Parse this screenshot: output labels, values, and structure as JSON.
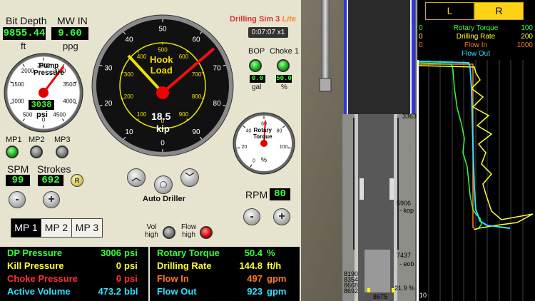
{
  "bit_depth": {
    "label": "Bit Depth",
    "value": "9855.44",
    "unit": "ft"
  },
  "mw_in": {
    "label": "MW IN",
    "value": "9.60",
    "unit": "ppg"
  },
  "pump_gauge": {
    "title1": "Pump",
    "title2": "Pressure",
    "value": "3038",
    "unit": "psi",
    "ticks": [
      "0",
      "500",
      "1000",
      "1500",
      "2000",
      "2500",
      "3000",
      "3500",
      "4000",
      "4500"
    ]
  },
  "hook_gauge": {
    "title1": "Hook",
    "title2": "Load",
    "value": "18.5",
    "unit": "kip",
    "outer_ticks": [
      "0",
      "10",
      "20",
      "30",
      "40",
      "50",
      "60",
      "70",
      "80",
      "90"
    ],
    "inner_ticks": [
      "0",
      "100",
      "200",
      "300",
      "400",
      "500",
      "600",
      "700",
      "800",
      "900"
    ]
  },
  "torque_gauge": {
    "title1": "Rotary",
    "title2": "Torque",
    "unit": "%",
    "ticks": [
      "0",
      "20",
      "40",
      "60",
      "80",
      "100"
    ]
  },
  "app_title": {
    "name": "Drilling Sim 3",
    "edition": "Lite"
  },
  "timer": "0:07:07 x1",
  "bop": {
    "label": "BOP",
    "value": "0.0",
    "unit": "gal"
  },
  "choke": {
    "label": "Choke 1",
    "value": "50.0",
    "unit": "%"
  },
  "pumps": {
    "mp1": "MP1",
    "mp2": "MP2",
    "mp3": "MP3"
  },
  "spm": {
    "label": "SPM",
    "value": "99"
  },
  "strokes": {
    "label": "Strokes",
    "value": "692",
    "reset": "R"
  },
  "buttons": {
    "minus": "-",
    "plus": "+",
    "auto_driller": "Auto Driller"
  },
  "rpm": {
    "label": "RPM",
    "value": "80"
  },
  "mp_tabs": [
    "MP 1",
    "MP 2",
    "MP 3"
  ],
  "alarms": {
    "vol_l1": "Vol",
    "vol_l2": "high",
    "flow_l1": "Flow",
    "flow_l2": "high"
  },
  "readouts_left": [
    {
      "label": "DP Pressure",
      "value": "3006",
      "unit": "psi",
      "color": "#39ff39"
    },
    {
      "label": "Kill Pressure",
      "value": "0",
      "unit": "psi",
      "color": "#ffff33"
    },
    {
      "label": "Choke Pressure",
      "value": "0",
      "unit": "psi",
      "color": "#ff3333"
    },
    {
      "label": "Active Volume",
      "value": "473.2",
      "unit": "bbl",
      "color": "#33e0ff"
    }
  ],
  "readouts_right": [
    {
      "label": "Rotary Torque",
      "value": "50.4",
      "unit": "%",
      "color": "#39ff39"
    },
    {
      "label": "Drilling Rate",
      "value": "144.8",
      "unit": "ft/h",
      "color": "#ffff33"
    },
    {
      "label": "Flow In",
      "value": "497",
      "unit": "gpm",
      "color": "#ff7a2a"
    },
    {
      "label": "Flow Out",
      "value": "923",
      "unit": "gpm",
      "color": "#33e0ff"
    }
  ],
  "well": {
    "depth_top": "3363",
    "kop_depth": "5906",
    "kop": "- kop",
    "eob_depth": "7437",
    "eob": "- eob",
    "d1": "8190",
    "d2": "8354",
    "d3": "8668",
    "d4": "8692",
    "pct": "21.9 %",
    "bottom": "8675"
  },
  "log": {
    "tab_l": "L",
    "tab_r": "R",
    "rows": [
      {
        "min": "0",
        "name": "Rotary Torque",
        "max": "100",
        "color": "#39ff39"
      },
      {
        "min": "0",
        "name": "Drilling Rate",
        "max": "200",
        "color": "#ffff33"
      },
      {
        "min": "0",
        "name": "Flow In",
        "max": "1000",
        "color": "#ff7a2a"
      },
      {
        "min": "",
        "name": "Flow Out",
        "max": "",
        "color": "#33e0ff"
      }
    ],
    "scale_bottom": "10"
  }
}
